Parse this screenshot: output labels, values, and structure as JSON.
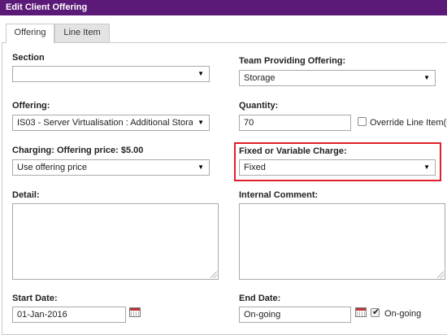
{
  "window": {
    "title": "Edit Client Offering"
  },
  "tabs": [
    {
      "label": "Offering",
      "active": true
    },
    {
      "label": "Line Item",
      "active": false
    }
  ],
  "form": {
    "section": {
      "label": "Section",
      "value": ""
    },
    "team": {
      "label": "Team Providing Offering:",
      "value": "Storage"
    },
    "offering": {
      "label": "Offering:",
      "value": "IS03 - Server Virtualisation : Additional Stora"
    },
    "quantity": {
      "label": "Quantity:",
      "value": "70"
    },
    "override": {
      "label": "Override Line Item(s",
      "checked": false
    },
    "charging": {
      "label": "Charging: Offering price: $5.00",
      "value": "Use offering price"
    },
    "charge_type": {
      "label": "Fixed or Variable Charge:",
      "value": "Fixed"
    },
    "detail": {
      "label": "Detail:"
    },
    "internal_comment": {
      "label": "Internal Comment:"
    },
    "start_date": {
      "label": "Start Date:",
      "value": "01-Jan-2016"
    },
    "end_date": {
      "label": "End Date:",
      "value": "On-going"
    },
    "ongoing": {
      "label": "On-going",
      "checked": true
    }
  },
  "colors": {
    "titlebar": "#5c1a78",
    "highlight": "#e0202a"
  },
  "icons": {
    "dropdown": "triangle-down-icon",
    "calendar": "calendar-icon"
  }
}
